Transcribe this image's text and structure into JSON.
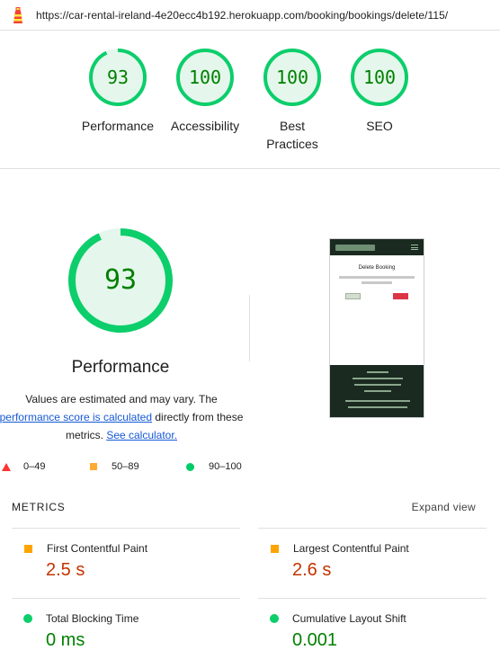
{
  "url": "https://car-rental-ireland-4e20ecc4b192.herokuapp.com/booking/bookings/delete/115/",
  "colors": {
    "pass": "#0cce6b",
    "average": "#ffa400",
    "fail": "#ff3333",
    "link": "#1558d6"
  },
  "summary_gauges": [
    {
      "label": "Performance",
      "score": "93",
      "fraction": 0.93
    },
    {
      "label": "Accessibility",
      "score": "100",
      "fraction": 1.0
    },
    {
      "label_line1": "Best",
      "label_line2": "Practices",
      "score": "100",
      "fraction": 1.0
    },
    {
      "label": "SEO",
      "score": "100",
      "fraction": 1.0
    }
  ],
  "performance": {
    "score": "93",
    "fraction": 0.93,
    "title": "Performance",
    "desc_part1": "Values are estimated and may vary. The",
    "desc_link1": "performance score is calculated",
    "desc_part2": " directly from these metrics. ",
    "desc_link2": "See calculator."
  },
  "thumbnail": {
    "page_title": "Delete Booking",
    "delete_label": "Delete"
  },
  "legend": {
    "fail": "0–49",
    "average": "50–89",
    "pass": "90–100"
  },
  "metrics": {
    "heading": "METRICS",
    "expand_label": "Expand view",
    "items": [
      {
        "name": "First Contentful Paint",
        "value": "2.5 s",
        "rating": "average"
      },
      {
        "name": "Largest Contentful Paint",
        "value": "2.6 s",
        "rating": "average"
      },
      {
        "name": "Total Blocking Time",
        "value": "0 ms",
        "rating": "pass"
      },
      {
        "name": "Cumulative Layout Shift",
        "value": "0.001",
        "rating": "pass"
      }
    ]
  }
}
